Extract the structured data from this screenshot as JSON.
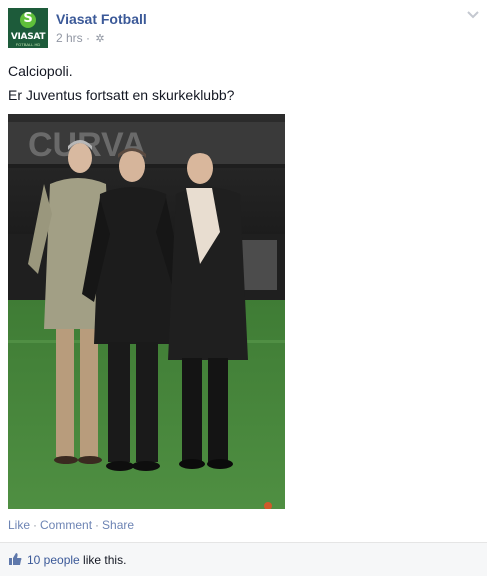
{
  "post": {
    "author": "Viasat Fotball",
    "time": "2 hrs",
    "audience_icon": "gear-icon",
    "message_line1": "Calciopoli.",
    "message_line2": "Er Juventus fortsatt en skurkeklubb?"
  },
  "avatar": {
    "logo_word": "VIASAT",
    "logo_sub": "FOTBALL HD",
    "logo_letter": "S"
  },
  "photo": {
    "banner_text": "CURVA"
  },
  "actions": {
    "like": "Like",
    "comment": "Comment",
    "share": "Share",
    "separator": "·"
  },
  "likes": {
    "count_link": "10 people",
    "suffix": " like this."
  },
  "colors": {
    "link": "#3b5998",
    "action": "#6d84b4",
    "meta": "#9197a3",
    "brand_green": "#5fbf3a"
  }
}
